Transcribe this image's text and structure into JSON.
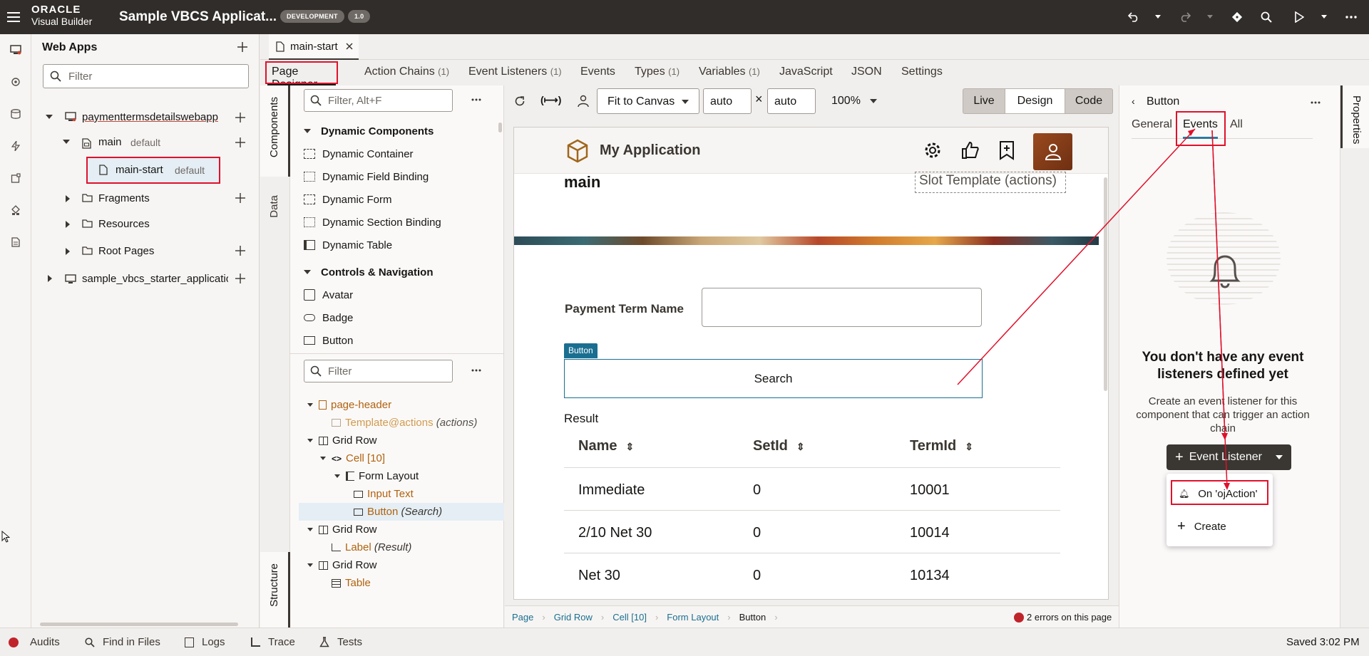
{
  "app": {
    "brand_top": "ORACLE",
    "brand_bottom": "Visual Builder",
    "title": "Sample VBCS Applicat...",
    "env_badge": "DEVELOPMENT",
    "version_badge": "1.0"
  },
  "nav": {
    "header": "Web Apps",
    "filter_placeholder": "Filter",
    "tree": {
      "webapp": "paymenttermsdetailswebapp",
      "main": "main",
      "main_tag": "default",
      "main_start": "main-start",
      "main_start_tag": "default",
      "fragments": "Fragments",
      "resources": "Resources",
      "root_pages": "Root Pages",
      "starter": "sample_vbcs_starter_applicatio"
    }
  },
  "editor": {
    "file_tab": "main-start",
    "subtabs": [
      {
        "label": "Page Designer",
        "count": ""
      },
      {
        "label": "Action Chains",
        "count": "(1)"
      },
      {
        "label": "Event Listeners",
        "count": "(1)"
      },
      {
        "label": "Events",
        "count": ""
      },
      {
        "label": "Types",
        "count": "(1)"
      },
      {
        "label": "Variables",
        "count": "(1)"
      },
      {
        "label": "JavaScript",
        "count": ""
      },
      {
        "label": "JSON",
        "count": ""
      },
      {
        "label": "Settings",
        "count": ""
      }
    ],
    "side_tabs": {
      "components": "Components",
      "data": "Data",
      "structure": "Structure"
    }
  },
  "palette": {
    "filter_placeholder": "Filter, Alt+F",
    "section1": "Dynamic Components",
    "section1_items": [
      "Dynamic Container",
      "Dynamic Field Binding",
      "Dynamic Form",
      "Dynamic Section Binding",
      "Dynamic Table"
    ],
    "section2": "Controls & Navigation",
    "section2_items": [
      "Avatar",
      "Badge",
      "Button"
    ]
  },
  "structure": {
    "filter_placeholder": "Filter",
    "rows": [
      {
        "label": "page-header",
        "suffix": ""
      },
      {
        "label": "Template@actions",
        "suffix": "(actions)"
      },
      {
        "label": "Grid Row",
        "suffix": ""
      },
      {
        "label": "Cell [10]",
        "suffix": ""
      },
      {
        "label": "Form Layout",
        "suffix": ""
      },
      {
        "label": "Input Text",
        "suffix": ""
      },
      {
        "label": "Button",
        "suffix": "(Search)"
      },
      {
        "label": "Grid Row",
        "suffix": ""
      },
      {
        "label": "Label",
        "suffix": "(Result)"
      },
      {
        "label": "Grid Row",
        "suffix": ""
      },
      {
        "label": "Table",
        "suffix": ""
      }
    ]
  },
  "canvas_toolbar": {
    "fit": "Fit to Canvas",
    "width": "auto",
    "times": "×",
    "height": "auto",
    "zoom": "100%",
    "modes": [
      "Live",
      "Design",
      "Code"
    ]
  },
  "canvas": {
    "app_title": "My Application",
    "page_title": "main",
    "slot_template": "Slot Template (actions)",
    "field_label": "Payment Term Name",
    "button_tag": "Button",
    "button_label": "Search",
    "result_label": "Result",
    "table": {
      "columns": [
        "Name",
        "SetId",
        "TermId"
      ],
      "rows": [
        [
          "Immediate",
          "0",
          "10001"
        ],
        [
          "2/10 Net 30",
          "0",
          "10014"
        ],
        [
          "Net 30",
          "0",
          "10134"
        ]
      ]
    }
  },
  "breadcrumbs": [
    "Page",
    "Grid Row",
    "Cell [10]",
    "Form Layout",
    "Button"
  ],
  "errors": "2 errors on this page",
  "props": {
    "component": "Button",
    "tabs": [
      "General",
      "Events",
      "All"
    ],
    "empty_title": "You don't have any event listeners defined yet",
    "empty_desc": "Create an event listener for this component that can trigger an action chain",
    "event_listener_btn": "Event Listener",
    "menu": [
      "On 'ojAction'",
      "Create"
    ],
    "side_label": "Properties"
  },
  "status": {
    "items": [
      "Audits",
      "Find in Files",
      "Logs",
      "Trace",
      "Tests"
    ],
    "saved": "Saved 3:02 PM"
  },
  "colors": {
    "topbar": "#312d2a",
    "highlight": "#e0112b",
    "tag_blue": "#1a6f91",
    "dark_button": "#3a3631"
  }
}
